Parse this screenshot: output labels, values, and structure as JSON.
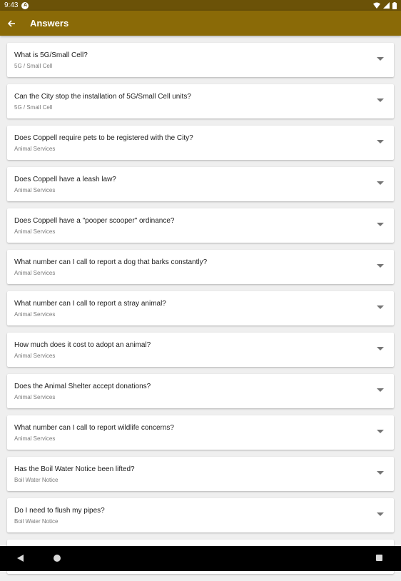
{
  "status": {
    "time": "9:43"
  },
  "appbar": {
    "title": "Answers"
  },
  "items": [
    {
      "question": "What is 5G/Small Cell?",
      "category": "5G / Small Cell"
    },
    {
      "question": "Can the City stop the installation of 5G/Small Cell units?",
      "category": "5G / Small Cell"
    },
    {
      "question": "Does Coppell require pets to be registered with the City?",
      "category": "Animal Services"
    },
    {
      "question": "Does Coppell have a leash law?",
      "category": "Animal Services"
    },
    {
      "question": "Does Coppell have a \"pooper scooper\" ordinance?",
      "category": "Animal Services"
    },
    {
      "question": "What number can I call to report a dog that barks constantly?",
      "category": "Animal Services"
    },
    {
      "question": "What number can I call to report a stray animal?",
      "category": "Animal Services"
    },
    {
      "question": "How much does it cost to adopt an animal?",
      "category": "Animal Services"
    },
    {
      "question": "Does the Animal Shelter accept donations?",
      "category": "Animal Services"
    },
    {
      "question": "What number can I call to report wildlife concerns?",
      "category": "Animal Services"
    },
    {
      "question": "Has the Boil Water Notice been lifted?",
      "category": "Boil Water Notice"
    },
    {
      "question": "Do I need to flush my pipes?",
      "category": "Boil Water Notice"
    }
  ]
}
